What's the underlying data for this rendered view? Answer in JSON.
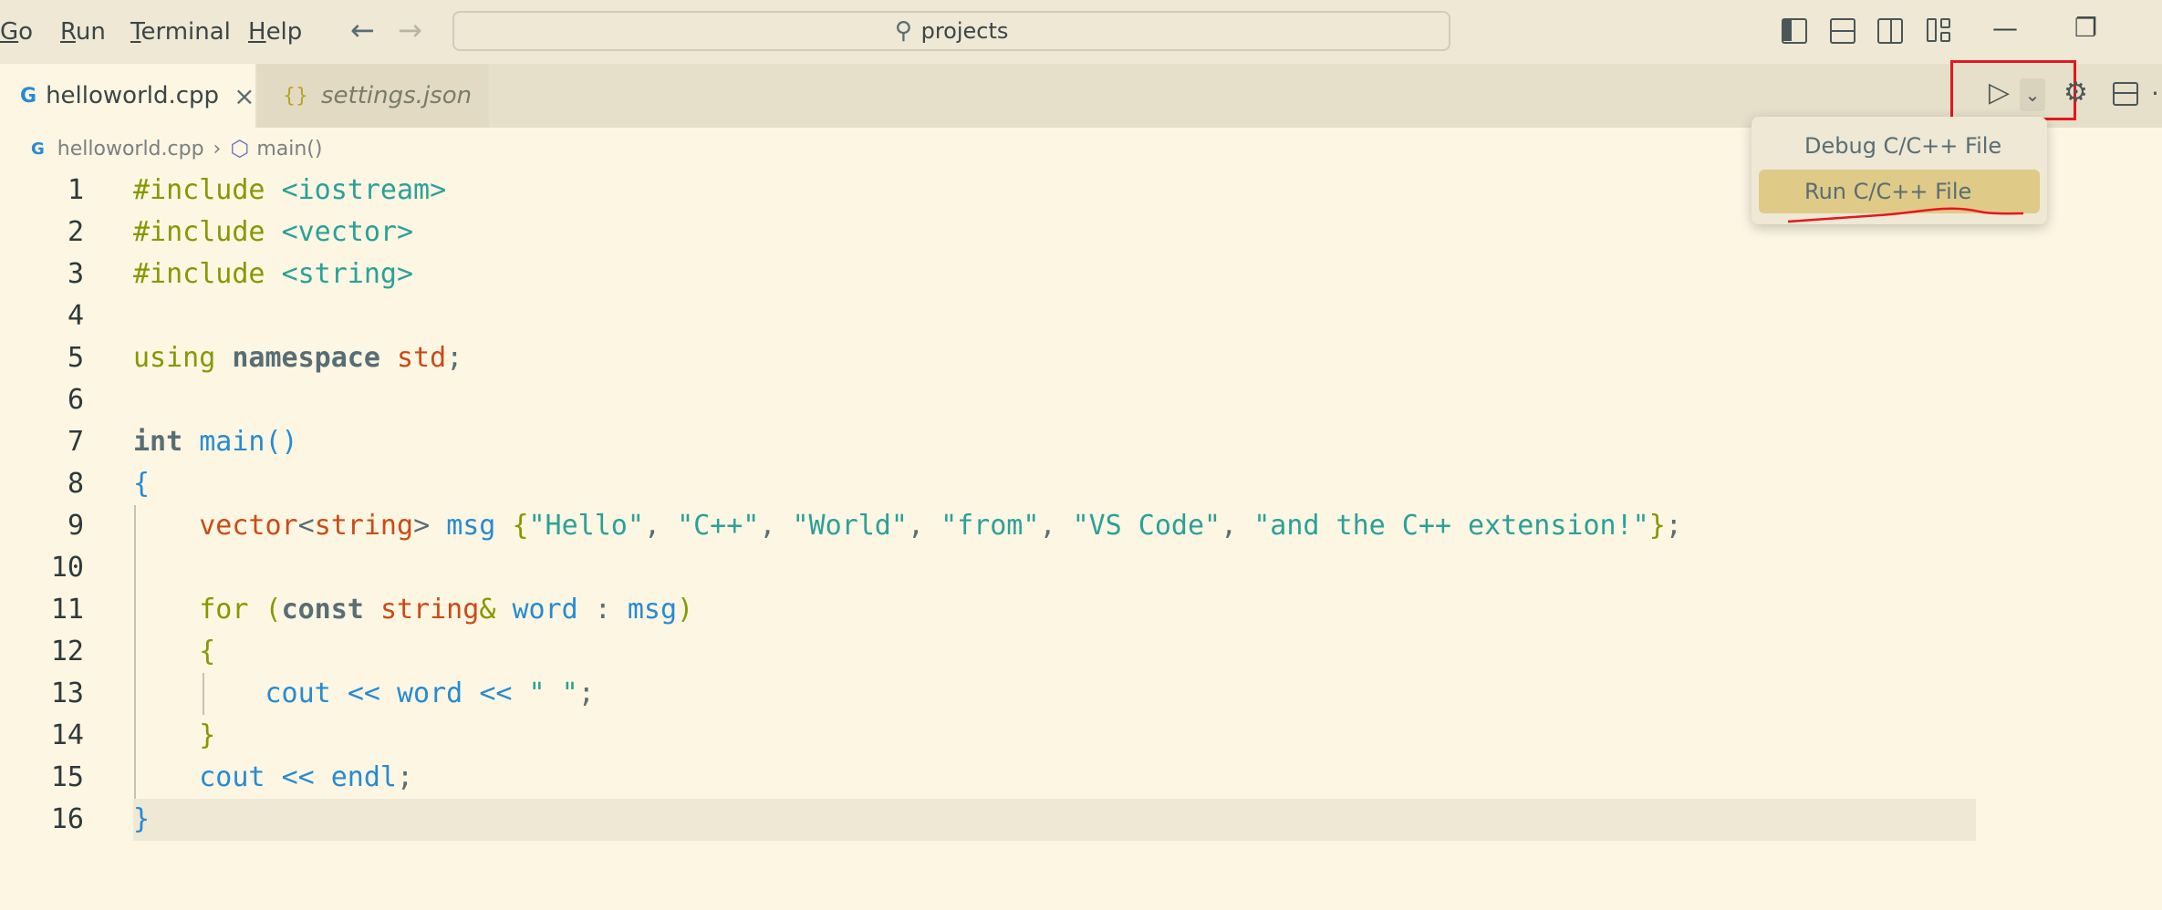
{
  "menubar": {
    "items": [
      {
        "label": "Go",
        "underline": "G",
        "rest": "o"
      },
      {
        "label": "Run",
        "underline": "R",
        "rest": "un"
      },
      {
        "label": "Terminal",
        "underline": "T",
        "rest": "erminal"
      },
      {
        "label": "Help",
        "underline": "H",
        "rest": "elp"
      }
    ]
  },
  "search": {
    "text": "projects"
  },
  "window_controls": {
    "minimize": "—",
    "restore": "❐"
  },
  "tabs": [
    {
      "label": "helloworld.cpp",
      "icon": "cpp-file-icon",
      "close": "×",
      "active": true
    },
    {
      "label": "settings.json",
      "icon": "json-file-icon",
      "active": false
    }
  ],
  "icons": {
    "cpp": "G",
    "json": "{}"
  },
  "breadcrumb": {
    "file": "helloworld.cpp",
    "symbol": "main()"
  },
  "run_menu": {
    "items": [
      {
        "label": "Debug C/C++ File"
      },
      {
        "label": "Run C/C++ File",
        "highlighted": true
      }
    ]
  },
  "editor": {
    "line_numbers": [
      "1",
      "2",
      "3",
      "4",
      "5",
      "6",
      "7",
      "8",
      "9",
      "10",
      "11",
      "12",
      "13",
      "14",
      "15",
      "16"
    ],
    "current_line": 16
  },
  "colors": {
    "accent": "#268bd2",
    "highlight": "#dfca88",
    "annotation": "#e8151c",
    "background": "#fdf6e3"
  }
}
